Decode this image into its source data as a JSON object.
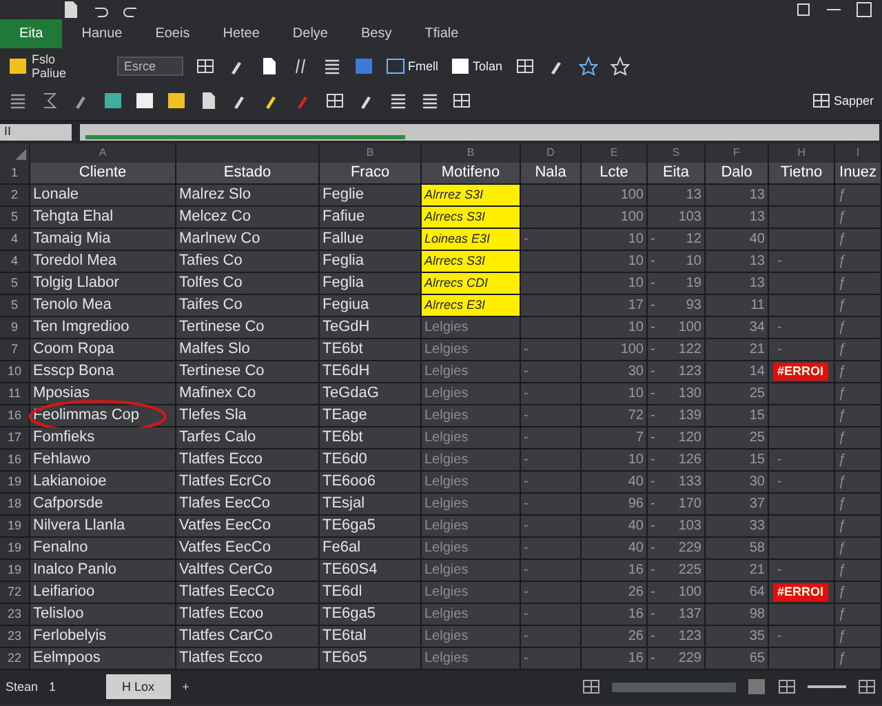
{
  "ribbon_tabs": [
    {
      "label": "Eita",
      "selected": true
    },
    {
      "label": "Hanue",
      "selected": false
    },
    {
      "label": "Eoeis",
      "selected": false
    },
    {
      "label": "Hetee",
      "selected": false
    },
    {
      "label": "Delye",
      "selected": false
    },
    {
      "label": "Besy",
      "selected": false
    },
    {
      "label": "Tfiale",
      "selected": false
    }
  ],
  "ribbon": {
    "paste_top": "Fslo",
    "paste_bottom": "Paliue",
    "font_box": "Esrce",
    "button_1": "Fmell",
    "button_2": "Tolan",
    "button_3": "Sapper"
  },
  "formula_bar": {
    "name_box": "II",
    "level": 0.4
  },
  "columns": [
    "A",
    "",
    "B",
    "B",
    "D",
    "E",
    "S",
    "F",
    "H",
    "I"
  ],
  "header": {
    "n": "1",
    "cells": [
      "Cliente",
      "Estado",
      "Fraco",
      "Motifeno",
      "Nala",
      "Lcte",
      "Eita",
      "Dalo",
      "Tietno",
      "Inuez"
    ]
  },
  "rows": [
    {
      "n": "2",
      "cliente": "Lonale",
      "estado": "Malrez Slo",
      "fraco": "Feglie",
      "motifeno": "Alrrrez S3I",
      "lcte": "100",
      "eita": "13",
      "dalo": "13",
      "fx": "ƒ",
      "highlighted": true,
      "error": false,
      "circled": false
    },
    {
      "n": "5",
      "cliente": "Tehgta Ehal",
      "estado": "Melcez Co",
      "fraco": "Fafiue",
      "motifeno": "Alrrecs S3I",
      "lcte": "100",
      "eita": "103",
      "dalo": "13",
      "fx": "ƒ",
      "highlighted": true,
      "error": false,
      "circled": false
    },
    {
      "n": "4",
      "cliente": "Tamaig Mia",
      "estado": "Marlnew Co",
      "fraco": "Fallue",
      "motifeno": "Loineas E3I",
      "nala": "-",
      "lcte": "10",
      "dash": "-",
      "eita": "12",
      "dalo": "40",
      "fx": "ƒ",
      "highlighted": true,
      "error": false,
      "circled": false
    },
    {
      "n": "4",
      "cliente": "Toredol Mea",
      "estado": "Tafies Co",
      "fraco": "Feglia",
      "motifeno": "Alrrecs S3I",
      "lcte": "10",
      "dash": "-",
      "eita": "10",
      "dalo": "13",
      "tietno": "-",
      "fx": "ƒ",
      "highlighted": true,
      "error": false,
      "circled": false
    },
    {
      "n": "5",
      "cliente": "Tolgig Llabor",
      "estado": "Tolfes Co",
      "fraco": "Feglia",
      "motifeno": "Alrrecs CDI",
      "lcte": "10",
      "dash": "-",
      "eita": "19",
      "dalo": "13",
      "fx": "ƒ",
      "highlighted": true,
      "error": false,
      "circled": false
    },
    {
      "n": "5",
      "cliente": "Tenolo Mea",
      "estado": "Taifes Co",
      "fraco": "Fegiua",
      "motifeno": "Alrrecs E3I",
      "lcte": "17",
      "dash": "-",
      "eita": "93",
      "dalo": "11",
      "fx": "ƒ",
      "highlighted": true,
      "error": false,
      "circled": false
    },
    {
      "n": "9",
      "cliente": "Ten Imgredioo",
      "estado": "Tertinese Co",
      "fraco": "TeGdH",
      "motifeno": "Lelgies",
      "lcte": "10",
      "dash": "-",
      "eita": "100",
      "dalo": "34",
      "tietno": "-",
      "fx": "ƒ",
      "highlighted": false,
      "error": false,
      "circled": false
    },
    {
      "n": "7",
      "cliente": "Coom Ropa",
      "estado": "Malfes Slo",
      "fraco": "TE6bt",
      "motifeno": "Lelgies",
      "nala": "-",
      "lcte": "100",
      "dash": "-",
      "eita": "122",
      "dalo": "21",
      "tietno": "-",
      "fx": "ƒ",
      "highlighted": false,
      "error": false,
      "circled": false
    },
    {
      "n": "10",
      "cliente": "Esscp Bona",
      "estado": "Tertinese Co",
      "fraco": "TE6dH",
      "motifeno": "Lelgies",
      "nala": "-",
      "lcte": "30",
      "dash": "-",
      "eita": "123",
      "dalo": "14",
      "tietno": "#ERROI",
      "fx": "ƒ",
      "highlighted": false,
      "error": true,
      "circled": false
    },
    {
      "n": "11",
      "cliente": "Mposias",
      "estado": "Mafinex Co",
      "fraco": "TeGdaG",
      "motifeno": "Lelgies",
      "nala": "-",
      "lcte": "10",
      "dash": "-",
      "eita": "130",
      "dalo": "25",
      "fx": "ƒ",
      "highlighted": false,
      "error": false,
      "circled": false
    },
    {
      "n": "16",
      "cliente": "Feolimmas Cop",
      "estado": "Tlefes Sla",
      "fraco": "TEage",
      "motifeno": "Lelgies",
      "nala": "-",
      "lcte": "72",
      "dash": "-",
      "eita": "139",
      "dalo": "15",
      "fx": "ƒ",
      "highlighted": false,
      "error": false,
      "circled": true
    },
    {
      "n": "17",
      "cliente": "Fomfieks",
      "estado": "Tarfes Calo",
      "fraco": "TE6bt",
      "motifeno": "Lelgies",
      "nala": "-",
      "lcte": "7",
      "dash": "-",
      "eita": "120",
      "dalo": "25",
      "fx": "ƒ",
      "highlighted": false,
      "error": false,
      "circled": false
    },
    {
      "n": "16",
      "cliente": "Fehlawo",
      "estado": "Tlatfes Ecco",
      "fraco": "TE6d0",
      "motifeno": "Lelgies",
      "nala": "-",
      "lcte": "10",
      "dash": "-",
      "eita": "126",
      "dalo": "15",
      "tietno": "-",
      "fx": "ƒ",
      "highlighted": false,
      "error": false,
      "circled": false
    },
    {
      "n": "19",
      "cliente": "Lakianoioe",
      "estado": "Tlatfes EcrCo",
      "fraco": "TE6oo6",
      "motifeno": "Lelgies",
      "nala": "-",
      "lcte": "40",
      "dash": "-",
      "eita": "133",
      "dalo": "30",
      "tietno": "-",
      "fx": "ƒ",
      "highlighted": false,
      "error": false,
      "circled": false
    },
    {
      "n": "18",
      "cliente": "Cafporsde",
      "estado": "Tlafes EecCo",
      "fraco": "TEsjal",
      "motifeno": "Lelgies",
      "nala": "-",
      "lcte": "96",
      "dash": "-",
      "eita": "170",
      "dalo": "37",
      "fx": "ƒ",
      "highlighted": false,
      "error": false,
      "circled": false
    },
    {
      "n": "19",
      "cliente": "Nilvera Llanla",
      "estado": "Vatfes EecCo",
      "fraco": "TE6ga5",
      "motifeno": "Lelgies",
      "nala": "-",
      "lcte": "40",
      "dash": "-",
      "eita": "103",
      "dalo": "33",
      "fx": "ƒ",
      "highlighted": false,
      "error": false,
      "circled": false
    },
    {
      "n": "19",
      "cliente": "Fenalno",
      "estado": "Vatfes EecCo",
      "fraco": "Fe6al",
      "motifeno": "Lelgies",
      "nala": "-",
      "lcte": "40",
      "dash": "-",
      "eita": "229",
      "dalo": "58",
      "fx": "ƒ",
      "highlighted": false,
      "error": false,
      "circled": false
    },
    {
      "n": "19",
      "cliente": "Inalco Panlo",
      "estado": "Valtfes CerCo",
      "fraco": "TE60S4",
      "motifeno": "Lelgies",
      "nala": "-",
      "lcte": "16",
      "dash": "-",
      "eita": "225",
      "dalo": "21",
      "tietno": "-",
      "fx": "ƒ",
      "highlighted": false,
      "error": false,
      "circled": false
    },
    {
      "n": "72",
      "cliente": "Leifiarioo",
      "estado": "Tlatfes EecCo",
      "fraco": "TE6dl",
      "motifeno": "Lelgies",
      "nala": "-",
      "lcte": "26",
      "dash": "-",
      "eita": "100",
      "dalo": "64",
      "tietno": "#ERROI",
      "fx": "ƒ",
      "highlighted": false,
      "error": true,
      "circled": false
    },
    {
      "n": "23",
      "cliente": "Telisloo",
      "estado": "Tlatfes Ecoo",
      "fraco": "TE6ga5",
      "motifeno": "Lelgies",
      "nala": "-",
      "lcte": "16",
      "dash": "-",
      "eita": "137",
      "dalo": "98",
      "fx": "ƒ",
      "highlighted": false,
      "error": false,
      "circled": false
    },
    {
      "n": "23",
      "cliente": "Ferlobelyis",
      "estado": "Tlatfes CarCo",
      "fraco": "TE6tal",
      "motifeno": "Lelgies",
      "nala": "-",
      "lcte": "26",
      "dash": "-",
      "eita": "123",
      "dalo": "35",
      "tietno": "-",
      "fx": "ƒ",
      "highlighted": false,
      "error": false,
      "circled": false
    },
    {
      "n": "22",
      "cliente": "Eelmpoos",
      "estado": "Tlatfes Ecco",
      "fraco": "TE6o5",
      "motifeno": "Lelgies",
      "nala": "-",
      "lcte": "16",
      "dash": "-",
      "eita": "229",
      "dalo": "65",
      "fx": "ƒ",
      "highlighted": false,
      "error": false,
      "circled": false
    }
  ],
  "status_bar": {
    "left": "Stean",
    "left_count": "1",
    "sheet_tabs": [
      {
        "label": "H Lox",
        "selected": true
      }
    ],
    "add": "+"
  }
}
